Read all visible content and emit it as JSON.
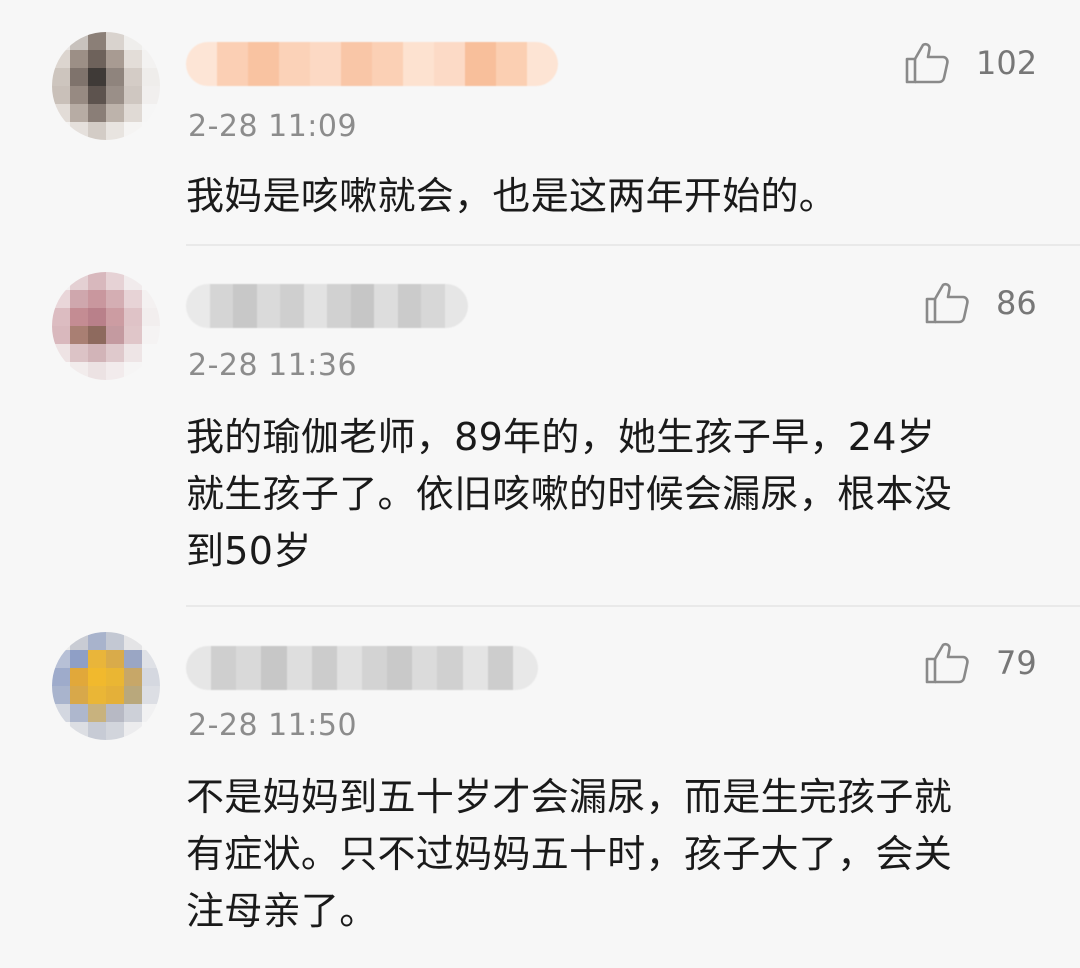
{
  "comments": [
    {
      "time": "2-28 11:09",
      "likes": "102",
      "text_lines": [
        "我妈是咳嗽就会，也是这两年开始的。"
      ],
      "avatar_colors": [
        "#e9e6e4",
        "#c8c2bd",
        "#8b7f77",
        "#d9d3ce",
        "#efeeec",
        "#f5f5f5",
        "#dcd5cf",
        "#9c8f86",
        "#6e625b",
        "#a89b92",
        "#e3ddd8",
        "#f3f2f1",
        "#cdc5be",
        "#7f736c",
        "#3f3a37",
        "#8f847d",
        "#d4ccc6",
        "#efedeb",
        "#c9c0b9",
        "#978a82",
        "#5d534e",
        "#9a8f88",
        "#cfc7c1",
        "#f1efee",
        "#e2dcd7",
        "#b7aca4",
        "#8a7e77",
        "#bdb3ab",
        "#e0dad5",
        "#f6f6f6",
        "#f4f3f2",
        "#e5e0dc",
        "#d3ccc6",
        "#e8e4e0",
        "#f5f4f3",
        "#f7f7f7"
      ],
      "name_colors": [
        "#fde5d6",
        "#fbcfb4",
        "#f9c3a1",
        "#fbd2b8",
        "#fcd9c4",
        "#f9c6a7",
        "#fbd0b5",
        "#fde2d0",
        "#fcdac6",
        "#f8bf9b",
        "#fbcfb2",
        "#fde4d4"
      ]
    },
    {
      "time": "2-28 11:36",
      "likes": "86",
      "text_lines": [
        "我的瑜伽老师，89年的，她生孩子早，24岁",
        "就生孩子了。依旧咳嗽的时候会漏尿，根本没",
        "到50岁"
      ],
      "avatar_colors": [
        "#f3eff0",
        "#e4d0d3",
        "#d8b8bd",
        "#e6d2d5",
        "#f1ebec",
        "#f7f7f7",
        "#e9d6d9",
        "#cfa7ad",
        "#c9979e",
        "#d4aeb3",
        "#e7d3d6",
        "#f4f1f1",
        "#dcbcc1",
        "#c48c93",
        "#b9808a",
        "#cc9ca2",
        "#dfc3c7",
        "#f2eeee",
        "#d9b8bd",
        "#a97f73",
        "#8e6a5e",
        "#c49aa0",
        "#e0c6c9",
        "#f5f3f3",
        "#eee3e4",
        "#dcc3c6",
        "#d2b4b8",
        "#dfc9cc",
        "#eee5e6",
        "#f7f7f7",
        "#f7f7f7",
        "#f2ecec",
        "#ece2e3",
        "#f2ebec",
        "#f6f5f5",
        "#f7f7f7"
      ],
      "name_colors": [
        "#e9e9e9",
        "#d5d5d5",
        "#c8c8c8",
        "#dadada",
        "#cfcfcf",
        "#e2e2e2",
        "#d1d1d1",
        "#c6c6c6",
        "#dddddd",
        "#cbcbcb",
        "#d7d7d7",
        "#e6e6e6"
      ]
    },
    {
      "time": "2-28 11:50",
      "likes": "79",
      "text_lines": [
        "不是妈妈到五十岁才会漏尿，而是生完孩子就",
        "有症状。只不过妈妈五十时，孩子大了，会关",
        "注母亲了。"
      ],
      "avatar_colors": [
        "#eaeaea",
        "#c9ccd4",
        "#a8b3cc",
        "#c3c8d3",
        "#e4e4e6",
        "#f5f5f5",
        "#b7c0d6",
        "#8f9fc6",
        "#e9b53a",
        "#d9ab4a",
        "#9aa6c4",
        "#dfe1e6",
        "#9eabcb",
        "#e1a83a",
        "#f1b92d",
        "#eab633",
        "#c7a768",
        "#d5d8e0",
        "#a9b4cd",
        "#d8a84a",
        "#eab636",
        "#e4b039",
        "#b9a87c",
        "#dcdee4",
        "#d3d7e0",
        "#aeb7cd",
        "#c8b27e",
        "#b7b9c4",
        "#cdd0d8",
        "#f1f1f2",
        "#f5f5f5",
        "#dcdee3",
        "#c7cbd5",
        "#d2d5dc",
        "#ececee",
        "#f7f7f7"
      ],
      "name_colors": [
        "#e6e6e6",
        "#cfcfcf",
        "#d9d9d9",
        "#c7c7c7",
        "#dedede",
        "#cccccc",
        "#e1e1e1",
        "#d3d3d3",
        "#c9c9c9",
        "#dbdbdb",
        "#d0d0d0",
        "#e4e4e4",
        "#cdcdcd",
        "#e8e8e8"
      ]
    }
  ]
}
